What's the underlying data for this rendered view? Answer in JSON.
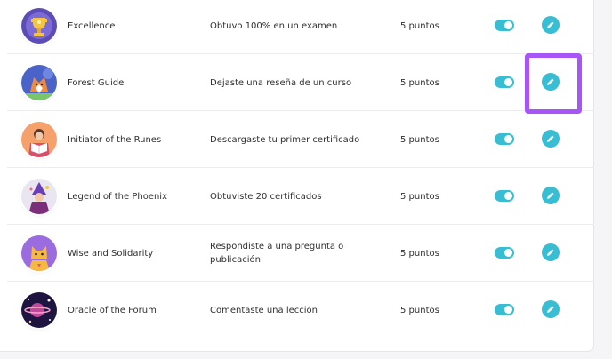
{
  "rows": [
    {
      "name": "Excellence",
      "description": "Obtuvo 100% en un examen",
      "points": "5 puntos",
      "enabled": true,
      "avatar": "trophy-avatar-icon"
    },
    {
      "name": "Forest Guide",
      "description": "Dejaste una reseña de un curso",
      "points": "5 puntos",
      "enabled": true,
      "avatar": "fox-avatar-icon"
    },
    {
      "name": "Initiator of the Runes",
      "description": "Descargaste tu primer certificado",
      "points": "5 puntos",
      "enabled": true,
      "avatar": "reader-avatar-icon"
    },
    {
      "name": "Legend of the Phoenix",
      "description": "Obtuviste 20 certificados",
      "points": "5 puntos",
      "enabled": true,
      "avatar": "wizard-avatar-icon"
    },
    {
      "name": "Wise and Solidarity",
      "description": "Respondiste a una pregunta o publicación",
      "points": "5 puntos",
      "enabled": true,
      "avatar": "cat-avatar-icon"
    },
    {
      "name": "Oracle of the Forum",
      "description": "Comentaste una lección",
      "points": "5 puntos",
      "enabled": true,
      "avatar": "space-avatar-icon"
    }
  ],
  "colors": {
    "accent": "#38bdd2",
    "highlight": "#a855f7"
  }
}
